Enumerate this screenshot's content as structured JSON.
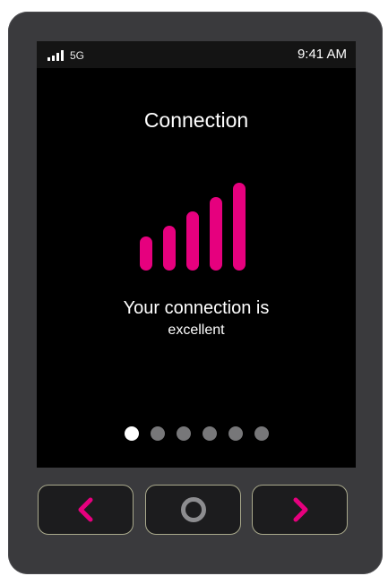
{
  "status_bar": {
    "signal_bars": 4,
    "network": "5G",
    "time": "9:41 AM"
  },
  "screen": {
    "title": "Connection",
    "signal_level": 5,
    "signal_max": 5,
    "message_line1": "Your connection is",
    "message_line2": "excellent",
    "page_count": 6,
    "current_page": 1
  },
  "icons": {
    "signal_status": "cellular-signal-icon",
    "signal_strength": "signal-strength-icon",
    "prev": "chevron-left-icon",
    "home": "circle-home-icon",
    "next": "chevron-right-icon"
  },
  "colors": {
    "accent": "#e6007e",
    "screen_bg": "#000000",
    "device_body": "#3a3a3d",
    "button_border": "#a9a98c",
    "dot_inactive": "#777779",
    "dot_active": "#ffffff"
  }
}
